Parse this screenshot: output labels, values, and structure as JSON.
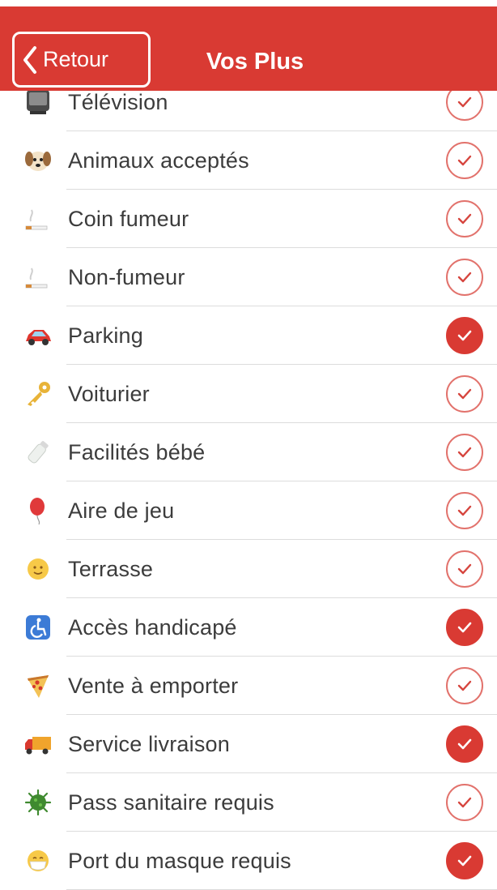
{
  "navbar": {
    "back_label": "Retour",
    "title": "Vos Plus",
    "background_color": "#d93a33"
  },
  "options": [
    {
      "label": "Télévision",
      "icon": "television-icon",
      "checked": false
    },
    {
      "label": "Animaux acceptés",
      "icon": "dog-icon",
      "checked": false
    },
    {
      "label": "Coin fumeur",
      "icon": "cigarette-icon",
      "checked": false
    },
    {
      "label": "Non-fumeur",
      "icon": "cigarette-icon",
      "checked": false
    },
    {
      "label": "Parking",
      "icon": "car-icon",
      "checked": true
    },
    {
      "label": "Voiturier",
      "icon": "key-icon",
      "checked": false
    },
    {
      "label": "Facilités bébé",
      "icon": "baby-bottle-icon",
      "checked": false
    },
    {
      "label": "Aire de jeu",
      "icon": "balloon-icon",
      "checked": false
    },
    {
      "label": "Terrasse",
      "icon": "sun-face-icon",
      "checked": false
    },
    {
      "label": "Accès handicapé",
      "icon": "wheelchair-icon",
      "checked": true
    },
    {
      "label": "Vente à emporter",
      "icon": "pizza-icon",
      "checked": false
    },
    {
      "label": "Service livraison",
      "icon": "delivery-truck-icon",
      "checked": true
    },
    {
      "label": "Pass sanitaire requis",
      "icon": "virus-icon",
      "checked": false
    },
    {
      "label": "Port du masque requis",
      "icon": "mask-face-icon",
      "checked": true
    }
  ]
}
